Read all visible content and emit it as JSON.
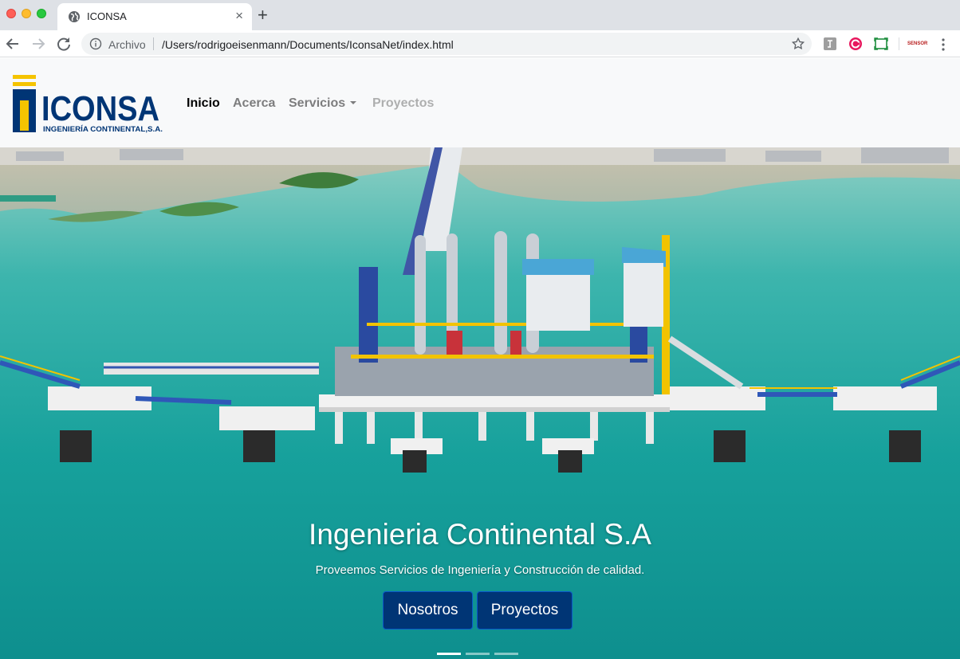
{
  "browser": {
    "tab_title": "ICONSA",
    "tab_close": "×",
    "new_tab": "+",
    "security_label": "Archivo",
    "url": "/Users/rodrigoeisenmann/Documents/IconsaNet/index.html",
    "extension_sensor_label": "SENSOR"
  },
  "navbar": {
    "brand": {
      "name": "ICONSA",
      "tagline": "INGENIERÍA CONTINENTAL,S.A."
    },
    "links": [
      {
        "label": "Inicio",
        "state": "active"
      },
      {
        "label": "Acerca",
        "state": "normal"
      },
      {
        "label": "Servicios",
        "state": "dropdown"
      },
      {
        "label": "Proyectos",
        "state": "disabled"
      }
    ]
  },
  "hero": {
    "title": "Ingenieria Continental S.A",
    "subtitle": "Proveemos Servicios de Ingeniería y Construcción de calidad.",
    "buttons": [
      {
        "label": "Nosotros"
      },
      {
        "label": "Proyectos"
      }
    ],
    "slides_count": 3,
    "active_slide": 1
  },
  "colors": {
    "brand_blue": "#003575",
    "brand_yellow": "#f5c400",
    "sea": "#1aa6a0",
    "navbar_bg": "#f8f9fa"
  }
}
